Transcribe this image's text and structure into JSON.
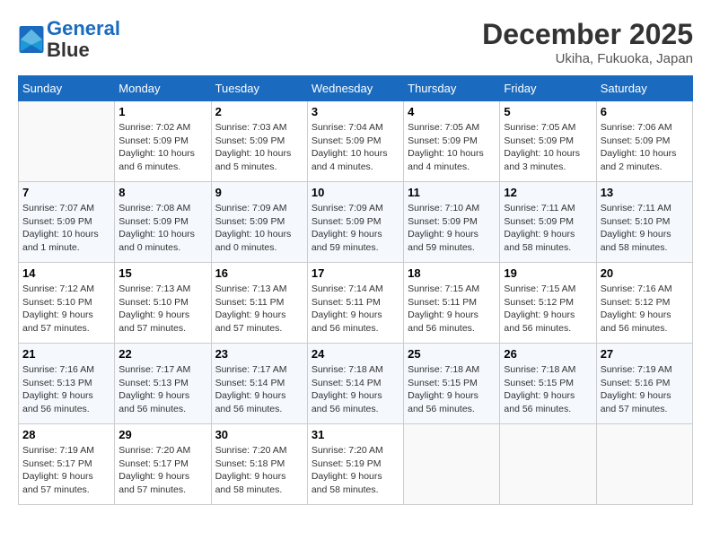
{
  "header": {
    "logo_line1": "General",
    "logo_line2": "Blue",
    "month": "December 2025",
    "location": "Ukiha, Fukuoka, Japan"
  },
  "weekdays": [
    "Sunday",
    "Monday",
    "Tuesday",
    "Wednesday",
    "Thursday",
    "Friday",
    "Saturday"
  ],
  "weeks": [
    [
      {
        "day": "",
        "info": ""
      },
      {
        "day": "1",
        "info": "Sunrise: 7:02 AM\nSunset: 5:09 PM\nDaylight: 10 hours\nand 6 minutes."
      },
      {
        "day": "2",
        "info": "Sunrise: 7:03 AM\nSunset: 5:09 PM\nDaylight: 10 hours\nand 5 minutes."
      },
      {
        "day": "3",
        "info": "Sunrise: 7:04 AM\nSunset: 5:09 PM\nDaylight: 10 hours\nand 4 minutes."
      },
      {
        "day": "4",
        "info": "Sunrise: 7:05 AM\nSunset: 5:09 PM\nDaylight: 10 hours\nand 4 minutes."
      },
      {
        "day": "5",
        "info": "Sunrise: 7:05 AM\nSunset: 5:09 PM\nDaylight: 10 hours\nand 3 minutes."
      },
      {
        "day": "6",
        "info": "Sunrise: 7:06 AM\nSunset: 5:09 PM\nDaylight: 10 hours\nand 2 minutes."
      }
    ],
    [
      {
        "day": "7",
        "info": "Sunrise: 7:07 AM\nSunset: 5:09 PM\nDaylight: 10 hours\nand 1 minute."
      },
      {
        "day": "8",
        "info": "Sunrise: 7:08 AM\nSunset: 5:09 PM\nDaylight: 10 hours\nand 0 minutes."
      },
      {
        "day": "9",
        "info": "Sunrise: 7:09 AM\nSunset: 5:09 PM\nDaylight: 10 hours\nand 0 minutes."
      },
      {
        "day": "10",
        "info": "Sunrise: 7:09 AM\nSunset: 5:09 PM\nDaylight: 9 hours\nand 59 minutes."
      },
      {
        "day": "11",
        "info": "Sunrise: 7:10 AM\nSunset: 5:09 PM\nDaylight: 9 hours\nand 59 minutes."
      },
      {
        "day": "12",
        "info": "Sunrise: 7:11 AM\nSunset: 5:09 PM\nDaylight: 9 hours\nand 58 minutes."
      },
      {
        "day": "13",
        "info": "Sunrise: 7:11 AM\nSunset: 5:10 PM\nDaylight: 9 hours\nand 58 minutes."
      }
    ],
    [
      {
        "day": "14",
        "info": "Sunrise: 7:12 AM\nSunset: 5:10 PM\nDaylight: 9 hours\nand 57 minutes."
      },
      {
        "day": "15",
        "info": "Sunrise: 7:13 AM\nSunset: 5:10 PM\nDaylight: 9 hours\nand 57 minutes."
      },
      {
        "day": "16",
        "info": "Sunrise: 7:13 AM\nSunset: 5:11 PM\nDaylight: 9 hours\nand 57 minutes."
      },
      {
        "day": "17",
        "info": "Sunrise: 7:14 AM\nSunset: 5:11 PM\nDaylight: 9 hours\nand 56 minutes."
      },
      {
        "day": "18",
        "info": "Sunrise: 7:15 AM\nSunset: 5:11 PM\nDaylight: 9 hours\nand 56 minutes."
      },
      {
        "day": "19",
        "info": "Sunrise: 7:15 AM\nSunset: 5:12 PM\nDaylight: 9 hours\nand 56 minutes."
      },
      {
        "day": "20",
        "info": "Sunrise: 7:16 AM\nSunset: 5:12 PM\nDaylight: 9 hours\nand 56 minutes."
      }
    ],
    [
      {
        "day": "21",
        "info": "Sunrise: 7:16 AM\nSunset: 5:13 PM\nDaylight: 9 hours\nand 56 minutes."
      },
      {
        "day": "22",
        "info": "Sunrise: 7:17 AM\nSunset: 5:13 PM\nDaylight: 9 hours\nand 56 minutes."
      },
      {
        "day": "23",
        "info": "Sunrise: 7:17 AM\nSunset: 5:14 PM\nDaylight: 9 hours\nand 56 minutes."
      },
      {
        "day": "24",
        "info": "Sunrise: 7:18 AM\nSunset: 5:14 PM\nDaylight: 9 hours\nand 56 minutes."
      },
      {
        "day": "25",
        "info": "Sunrise: 7:18 AM\nSunset: 5:15 PM\nDaylight: 9 hours\nand 56 minutes."
      },
      {
        "day": "26",
        "info": "Sunrise: 7:18 AM\nSunset: 5:15 PM\nDaylight: 9 hours\nand 56 minutes."
      },
      {
        "day": "27",
        "info": "Sunrise: 7:19 AM\nSunset: 5:16 PM\nDaylight: 9 hours\nand 57 minutes."
      }
    ],
    [
      {
        "day": "28",
        "info": "Sunrise: 7:19 AM\nSunset: 5:17 PM\nDaylight: 9 hours\nand 57 minutes."
      },
      {
        "day": "29",
        "info": "Sunrise: 7:20 AM\nSunset: 5:17 PM\nDaylight: 9 hours\nand 57 minutes."
      },
      {
        "day": "30",
        "info": "Sunrise: 7:20 AM\nSunset: 5:18 PM\nDaylight: 9 hours\nand 58 minutes."
      },
      {
        "day": "31",
        "info": "Sunrise: 7:20 AM\nSunset: 5:19 PM\nDaylight: 9 hours\nand 58 minutes."
      },
      {
        "day": "",
        "info": ""
      },
      {
        "day": "",
        "info": ""
      },
      {
        "day": "",
        "info": ""
      }
    ]
  ]
}
